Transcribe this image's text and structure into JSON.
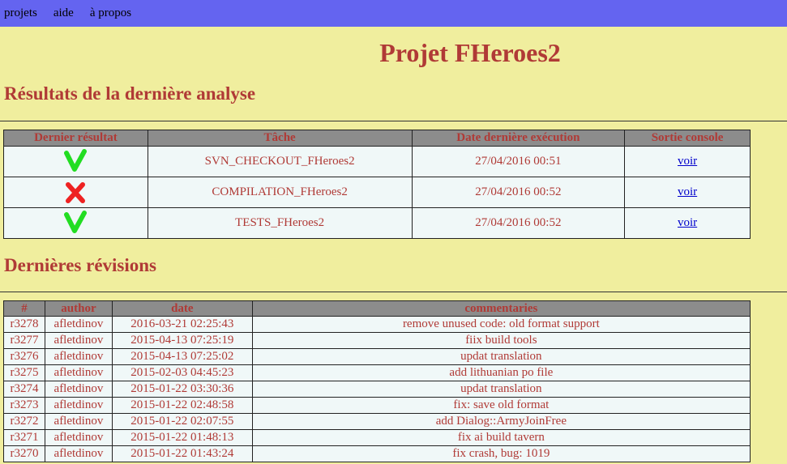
{
  "nav": {
    "items": [
      {
        "label": "projets"
      },
      {
        "label": "aide"
      },
      {
        "label": "à propos"
      }
    ]
  },
  "page_title": "Projet FHeroes2",
  "analysis": {
    "heading": "Résultats de la dernière analyse",
    "columns": [
      "Dernier résultat",
      "Tâche",
      "Date dernière exécution",
      "Sortie console"
    ],
    "rows": [
      {
        "result": "success",
        "icon": "check-icon",
        "task": "SVN_CHECKOUT_FHeroes2",
        "date": "27/04/2016 00:51",
        "link": "voir"
      },
      {
        "result": "failure",
        "icon": "cross-icon",
        "task": "COMPILATION_FHeroes2",
        "date": "27/04/2016 00:52",
        "link": "voir"
      },
      {
        "result": "success",
        "icon": "check-icon",
        "task": "TESTS_FHeroes2",
        "date": "27/04/2016 00:52",
        "link": "voir"
      }
    ]
  },
  "revisions": {
    "heading": "Dernières révisions",
    "columns": [
      "#",
      "author",
      "date",
      "commentaries"
    ],
    "rows": [
      {
        "rev": "r3278",
        "author": "afletdinov",
        "date": "2016-03-21 02:25:43",
        "comment": "remove unused code: old format support"
      },
      {
        "rev": "r3277",
        "author": "afletdinov",
        "date": "2015-04-13 07:25:19",
        "comment": "fiix build tools"
      },
      {
        "rev": "r3276",
        "author": "afletdinov",
        "date": "2015-04-13 07:25:02",
        "comment": "updat translation"
      },
      {
        "rev": "r3275",
        "author": "afletdinov",
        "date": "2015-02-03 04:45:23",
        "comment": "add lithuanian po file"
      },
      {
        "rev": "r3274",
        "author": "afletdinov",
        "date": "2015-01-22 03:30:36",
        "comment": "updat translation"
      },
      {
        "rev": "r3273",
        "author": "afletdinov",
        "date": "2015-01-22 02:48:58",
        "comment": "fix: save old format"
      },
      {
        "rev": "r3272",
        "author": "afletdinov",
        "date": "2015-01-22 02:07:55",
        "comment": "add Dialog::ArmyJoinFree"
      },
      {
        "rev": "r3271",
        "author": "afletdinov",
        "date": "2015-01-22 01:48:13",
        "comment": "fix ai build tavern"
      },
      {
        "rev": "r3270",
        "author": "afletdinov",
        "date": "2015-01-22 01:43:24",
        "comment": "fix crash, bug: 1019"
      }
    ]
  },
  "colors": {
    "background": "#f0ee9e",
    "nav_background": "#6464f0",
    "heading": "#b03a36",
    "table_header": "#8c8c8c",
    "cell_background": "#f0f8f8",
    "success": "#22dd22",
    "failure": "#ee2222",
    "link": "#0000cc"
  }
}
